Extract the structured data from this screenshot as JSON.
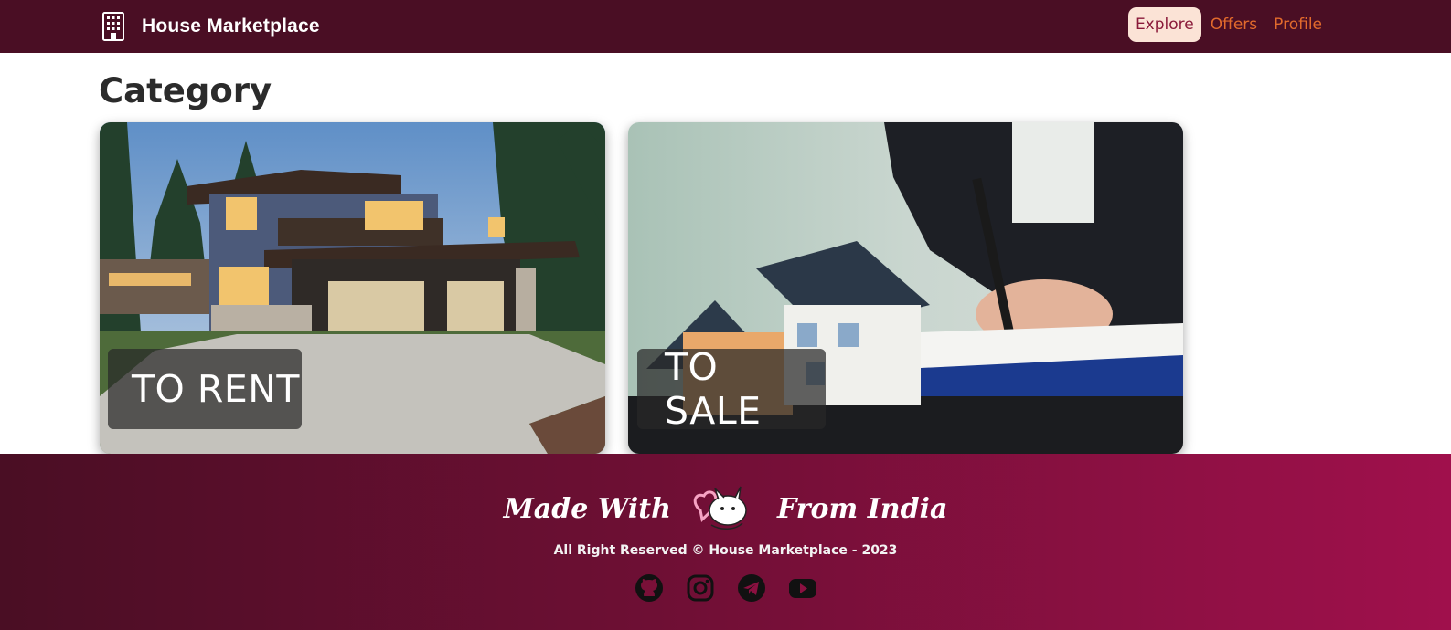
{
  "navbar": {
    "brand_icon": "building-icon",
    "brand_title": "House Marketplace",
    "links": [
      {
        "label": "Explore",
        "active": true
      },
      {
        "label": "Offers",
        "active": false
      },
      {
        "label": "Profile",
        "active": false
      }
    ]
  },
  "main": {
    "title": "Category",
    "categories": [
      {
        "label": "TO RENT",
        "image": "modern-house-photo"
      },
      {
        "label": "TO SALE",
        "image": "house-model-contract-photo"
      }
    ]
  },
  "footer": {
    "made_with": "Made With",
    "from_india": "From India",
    "logo_icon": "heart-mascot-icon",
    "rights": "All Right Reserved © House Marketplace - 2023",
    "socials": [
      "github-icon",
      "instagram-icon",
      "telegram-icon",
      "youtube-icon"
    ]
  },
  "colors": {
    "navbar_bg": "#4a0e24",
    "accent": "#e26a2c",
    "active_pill": "#fbe3d6",
    "footer_gradient_start": "#4a0e24",
    "footer_gradient_end": "#a0104c"
  }
}
